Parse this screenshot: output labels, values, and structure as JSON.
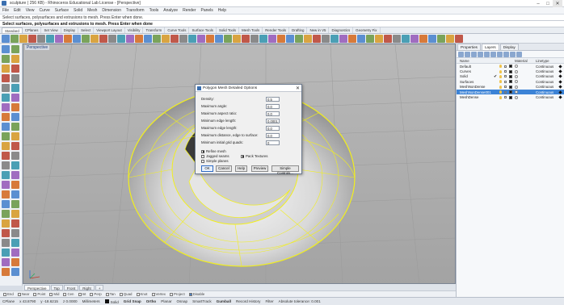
{
  "window": {
    "title": "sculpture ( 256 KB) - Rhinoceros Educational Lab License - [Perspective]"
  },
  "menu": [
    "File",
    "Edit",
    "View",
    "Curve",
    "Surface",
    "Solid",
    "Mesh",
    "Dimension",
    "Transform",
    "Tools",
    "Analyze",
    "Render",
    "Panels",
    "Help"
  ],
  "command": {
    "history": "Select surfaces, polysurfaces and extrusions to mesh. Press Enter when done.",
    "prompt": "Select surfaces, polysurfaces and extrusions to mesh. Press Enter when done"
  },
  "toolbar_tabs": [
    "Standard",
    "CPlanes",
    "Set View",
    "Display",
    "Select",
    "Viewport Layout",
    "Visibility",
    "Transform",
    "Curve Tools",
    "Surface Tools",
    "Solid Tools",
    "Mesh Tools",
    "Render Tools",
    "Drafting",
    "New in V5",
    "Diagnostics",
    "Geometry Fix"
  ],
  "viewport": {
    "label": "Perspective"
  },
  "view_tabs": [
    "Perspective",
    "Top",
    "Front",
    "Right",
    "+"
  ],
  "osnaps": [
    {
      "label": "End",
      "checked": false
    },
    {
      "label": "Near",
      "checked": false
    },
    {
      "label": "Point",
      "checked": false
    },
    {
      "label": "Mid",
      "checked": false
    },
    {
      "label": "Cen",
      "checked": false
    },
    {
      "label": "Int",
      "checked": false
    },
    {
      "label": "Perp",
      "checked": false
    },
    {
      "label": "Tan",
      "checked": false
    },
    {
      "label": "Quad",
      "checked": false
    },
    {
      "label": "Knot",
      "checked": false
    },
    {
      "label": "Vertex",
      "checked": false
    },
    {
      "label": "Project",
      "checked": false
    },
    {
      "label": "Disable",
      "checked": true
    }
  ],
  "status": {
    "cplane": "CPlane",
    "x": "x 43.8790",
    "y": "y -18.6215",
    "z": "z 0.0000",
    "units": "Millimeters",
    "layer": "Solid",
    "grid_snap": "Grid Snap",
    "ortho": "Ortho",
    "planar": "Planar",
    "osnap": "Osnap",
    "smarttrack": "SmartTrack",
    "gumball": "Gumball",
    "record_history": "Record History",
    "filter": "Filter",
    "tolerance": "Absolute tolerance: 0.001"
  },
  "panel": {
    "tabs": [
      "Properties",
      "Layers",
      "Display"
    ],
    "columns": {
      "name": "Name",
      "material": "Material",
      "linetype": "Linetype"
    },
    "layers": [
      {
        "name": "Default",
        "linetype": "Continuous",
        "color": "#111111",
        "current": false,
        "selected": false
      },
      {
        "name": "Curves",
        "linetype": "Continuous",
        "color": "#111111",
        "current": false,
        "selected": false
      },
      {
        "name": "Solid",
        "linetype": "Continuous",
        "color": "#111111",
        "current": true,
        "selected": false
      },
      {
        "name": "Surfaces",
        "linetype": "Continuous",
        "color": "#111111",
        "current": false,
        "selected": false
      },
      {
        "name": "MeshNonDense",
        "linetype": "Continuous",
        "color": "#111111",
        "current": false,
        "selected": false
      },
      {
        "name": "MeshNonDense001",
        "linetype": "Continuous",
        "color": "#111111",
        "current": false,
        "selected": true
      },
      {
        "name": "MeshDense",
        "linetype": "Continuous",
        "color": "#111111",
        "current": false,
        "selected": false
      }
    ]
  },
  "dialog": {
    "title": "Polygon Mesh Detailed Options",
    "fields": [
      {
        "label": "Density:",
        "value": "0.5"
      },
      {
        "label": "Maximum angle:",
        "value": "0.0"
      },
      {
        "label": "Maximum aspect ratio:",
        "value": "0.0"
      },
      {
        "label": "Minimum edge length:",
        "value": "0.0001"
      },
      {
        "label": "Maximum edge length:",
        "value": "0.0"
      },
      {
        "label": "Maximum distance, edge to surface:",
        "value": "0.0"
      },
      {
        "label": "Minimum initial grid quads:",
        "value": "0"
      }
    ],
    "checkboxes": [
      {
        "label": "Refine mesh",
        "checked": true
      },
      {
        "label": "Jagged seams",
        "checked": false
      },
      {
        "label": "Simple planes",
        "checked": false
      },
      {
        "label": "Pack Textures",
        "checked": true
      }
    ],
    "buttons": {
      "ok": "OK",
      "cancel": "Cancel",
      "help": "Help",
      "preview": "Preview",
      "simple": "Simple Controls..."
    }
  },
  "colors": {
    "accent": "#3c83d6",
    "selection": "#f2ef1d",
    "viewport_bg": "#a8a8a8"
  }
}
